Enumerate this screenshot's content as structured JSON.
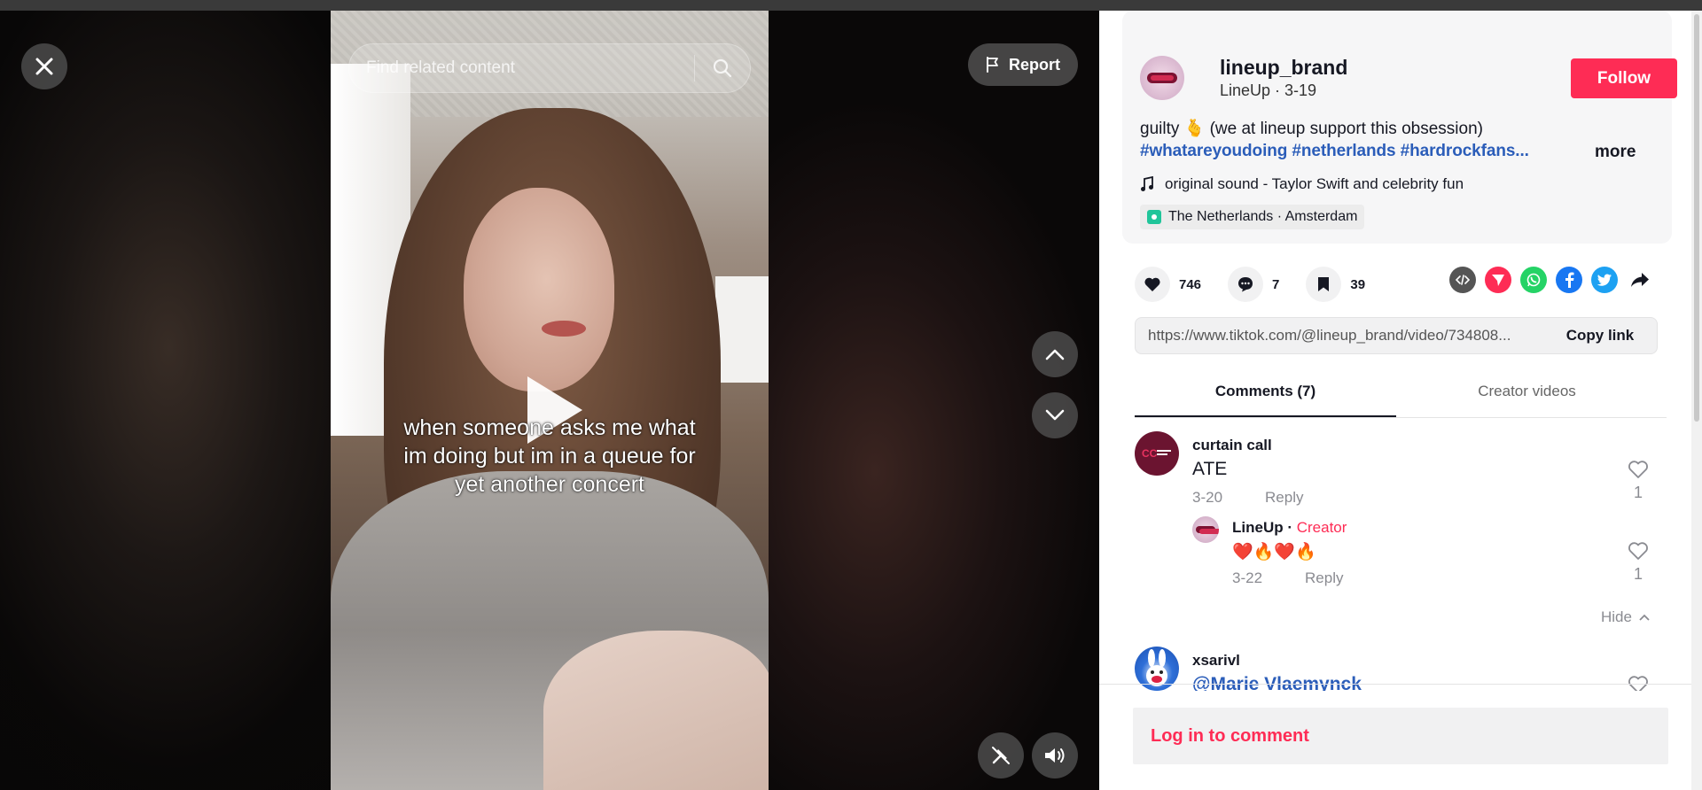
{
  "search": {
    "placeholder": "Find related content"
  },
  "report_label": "Report",
  "video": {
    "caption": "when someone asks me what im doing but im in a queue for yet another concert"
  },
  "author": {
    "username": "lineup_brand",
    "nickname": "LineUp",
    "date": "3-19",
    "subline": "LineUp · 3-19",
    "follow_label": "Follow"
  },
  "description": {
    "text": "guilty 🫰 (we at lineup support this obsession)",
    "hashtags": "#whatareyoudoing #netherlands #hardrockfans...",
    "more_label": "more"
  },
  "music": {
    "label": "original sound - Taylor Swift and celebrity fun"
  },
  "location": {
    "label": "The Netherlands · Amsterdam"
  },
  "stats": {
    "likes": "746",
    "comments": "7",
    "saves": "39"
  },
  "share_icons": [
    "embed-icon",
    "send-icon",
    "whatsapp-icon",
    "facebook-icon",
    "twitter-icon",
    "share-arrow-icon"
  ],
  "link": {
    "url": "https://www.tiktok.com/@lineup_brand/video/734808...",
    "copy_label": "Copy link"
  },
  "tabs": [
    {
      "label": "Comments (7)",
      "active": true
    },
    {
      "label": "Creator videos",
      "active": false
    }
  ],
  "comments": [
    {
      "user": "curtain call",
      "text": "ATE",
      "date": "3-20",
      "reply_label": "Reply",
      "likes": "1",
      "replies": [
        {
          "user": "LineUp",
          "badge": "Creator",
          "separator": " · ",
          "text": "❤️🔥❤️🔥",
          "date": "3-22",
          "reply_label": "Reply",
          "likes": "1"
        }
      ],
      "hide_label": "Hide"
    },
    {
      "user": "xsarivl",
      "text": "@Marie Vlaemynck"
    }
  ],
  "login_label": "Log in to comment",
  "colors": {
    "accent": "#fe2c55",
    "hashtag": "#2b5db9",
    "location_pin": "#20c59a"
  }
}
